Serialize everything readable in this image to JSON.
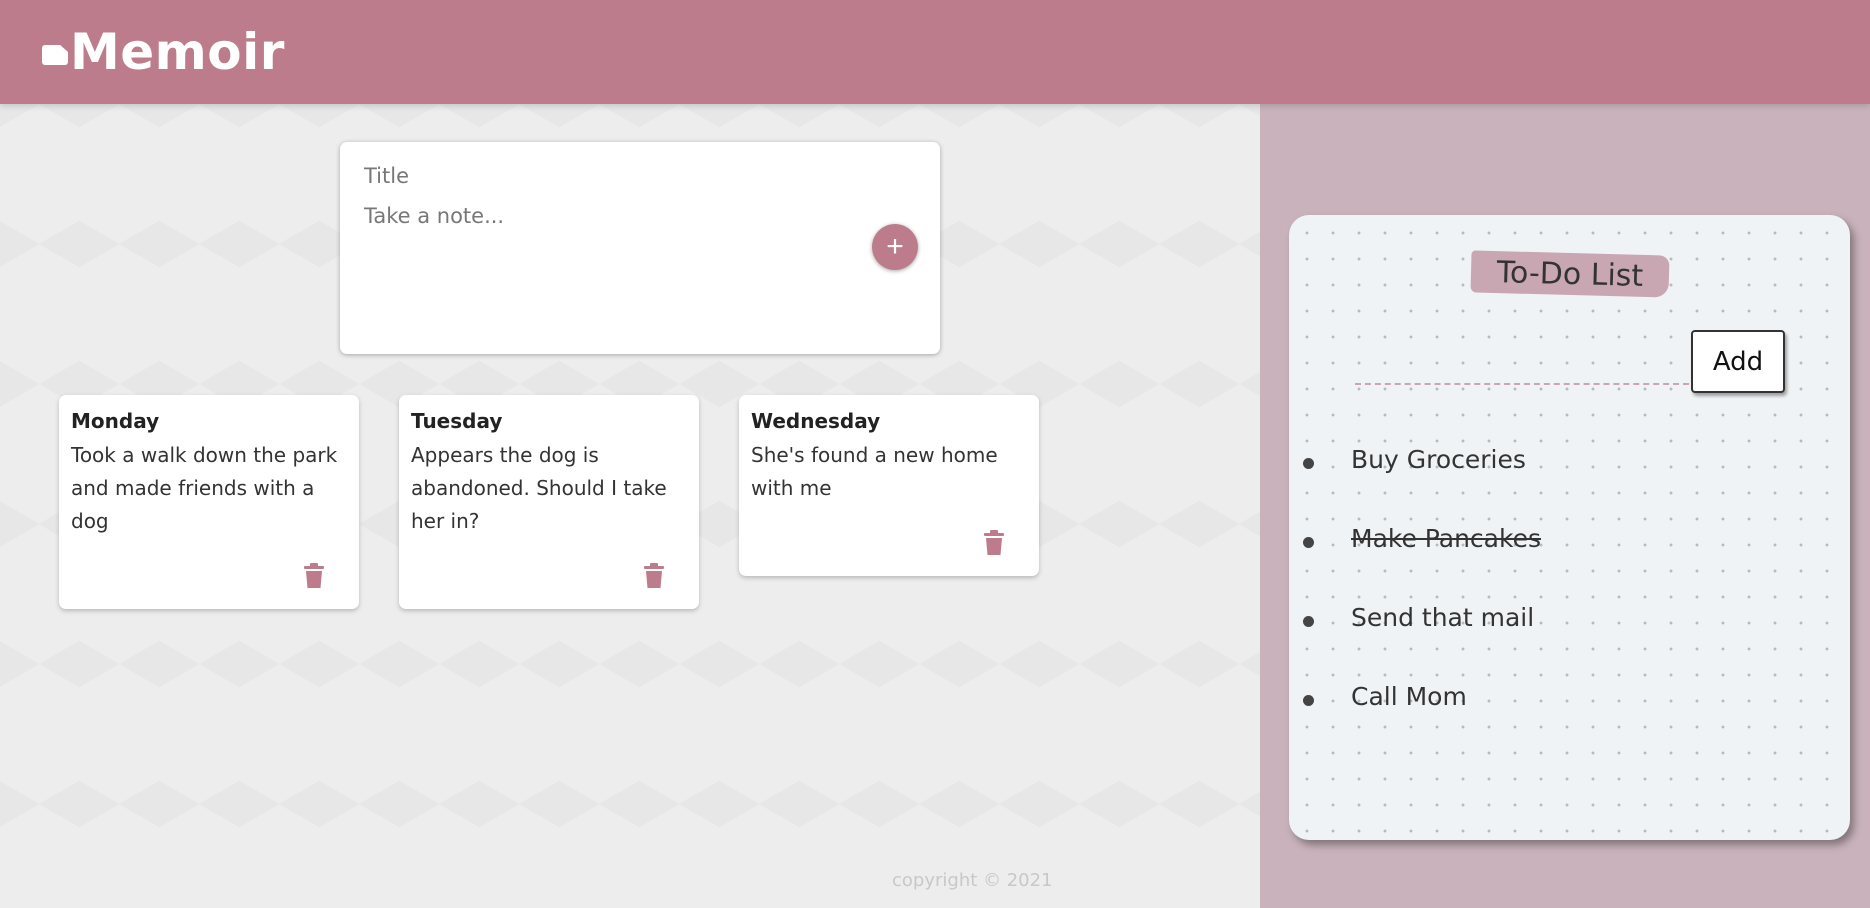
{
  "header": {
    "title": "Memoir"
  },
  "composer": {
    "title_placeholder": "Title",
    "content_placeholder": "Take a note..."
  },
  "notes": [
    {
      "title": "Monday",
      "content": "Took a walk down the park and made friends with a dog"
    },
    {
      "title": "Tuesday",
      "content": "Appears the dog is abandoned. Should I take her in?"
    },
    {
      "title": "Wednesday",
      "content": "She's found a new home with me"
    }
  ],
  "footer": {
    "text": "copyright © 2021"
  },
  "todo": {
    "title": "To-Do List",
    "add_label": "Add",
    "items": [
      {
        "text": "Buy Groceries",
        "done": false
      },
      {
        "text": "Make Pancakes",
        "done": true
      },
      {
        "text": "Send that mail",
        "done": false
      },
      {
        "text": "Call Mom",
        "done": false
      }
    ]
  },
  "colors": {
    "accent": "#bc7c8b",
    "side_panel": "#c9b2bb",
    "todo_title_bg": "#c9a7b2"
  },
  "icons": {
    "add": "plus-icon",
    "delete": "trash-icon",
    "logo": "note-icon"
  }
}
